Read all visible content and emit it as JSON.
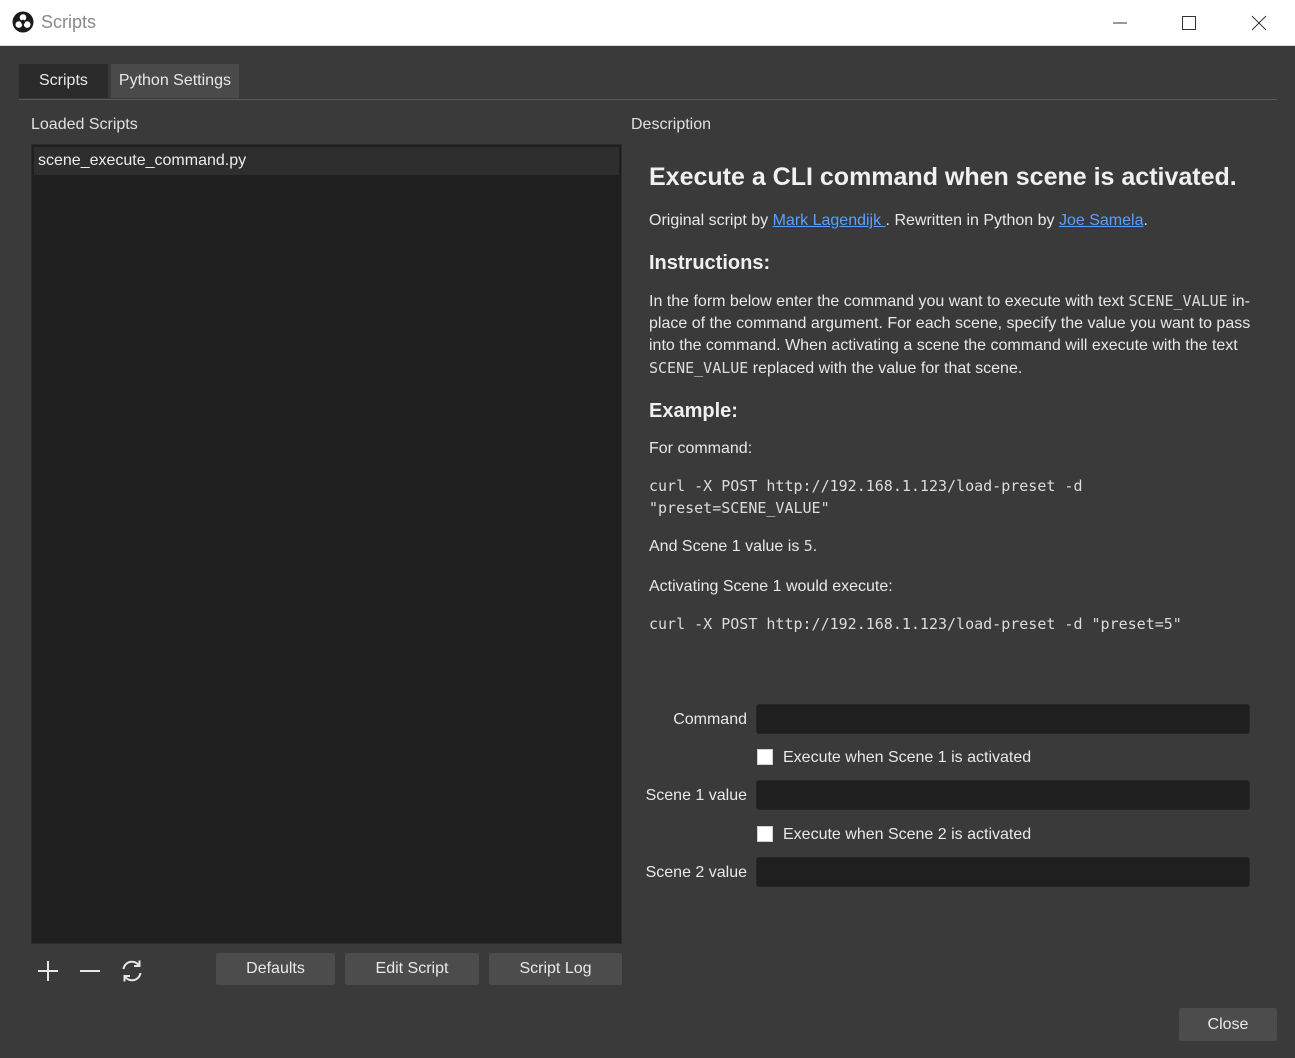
{
  "window": {
    "title": "Scripts"
  },
  "tabs": [
    {
      "label": "Scripts",
      "active": true
    },
    {
      "label": "Python Settings",
      "active": false
    }
  ],
  "loaded_scripts": {
    "label": "Loaded Scripts",
    "items": [
      "scene_execute_command.py"
    ]
  },
  "description": {
    "label": "Description",
    "heading": "Execute a CLI command when scene is activated.",
    "credit_prefix": "Original script by ",
    "author1": "Mark Lagendijk ",
    "credit_mid": ". Rewritten in Python by ",
    "author2": "Joe Samela",
    "credit_suffix": ".",
    "instructions_heading": "Instructions:",
    "instr_1": "In the form below enter the command you want to execute with text ",
    "instr_code1": "SCENE_VALUE",
    "instr_2": " in-place of the command argument. For each scene, specify the value you want to pass into the command. When activating a scene the command will execute with the text ",
    "instr_code2": "SCENE_VALUE",
    "instr_3": " replaced with the value for that scene.",
    "example_heading": "Example:",
    "for_command": "For command:",
    "example_code": "curl -X POST http://192.168.1.123/load-preset -d \"preset=SCENE_VALUE\"",
    "scene1_prefix": "And Scene 1 value is ",
    "scene1_value": "5",
    "scene1_suffix": ".",
    "activating": "Activating Scene 1 would execute:",
    "result_code": "curl -X POST http://192.168.1.123/load-preset -d \"preset=5\""
  },
  "form": {
    "command_label": "Command",
    "command_value": "",
    "exec1_label": "Execute when Scene 1 is activated",
    "exec1_checked": false,
    "scene1_label": "Scene 1 value",
    "scene1_value": "",
    "exec2_label": "Execute when Scene 2 is activated",
    "exec2_checked": false,
    "scene2_label": "Scene 2 value",
    "scene2_value": ""
  },
  "buttons": {
    "add_icon": "plus-icon",
    "remove_icon": "minus-icon",
    "reload_icon": "reload-icon",
    "defaults": "Defaults",
    "edit_script": "Edit Script",
    "script_log": "Script Log",
    "close": "Close"
  },
  "colors": {
    "background": "#3a3a3a",
    "list_bg": "#1f1f1f",
    "link": "#5aa0ff"
  }
}
